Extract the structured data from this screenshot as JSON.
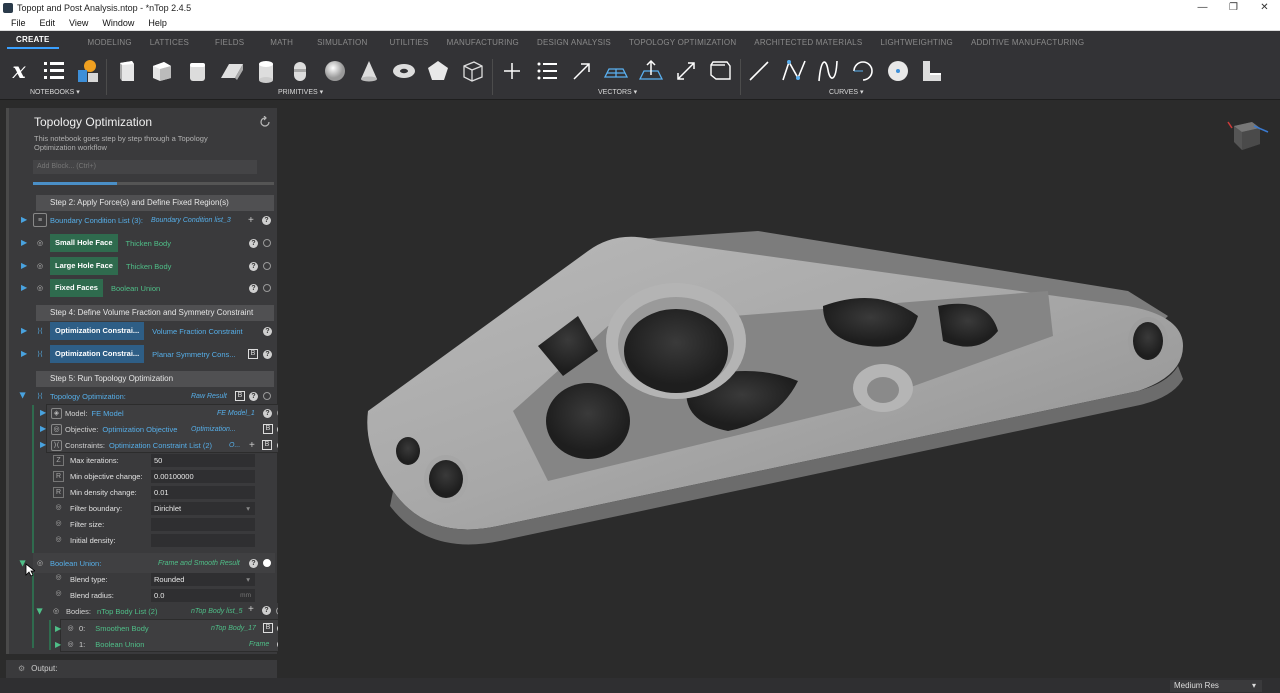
{
  "window": {
    "title": "Topopt and Post Analysis.ntop - *nTop 2.4.5",
    "controls": [
      "—",
      "❐",
      "✕"
    ]
  },
  "menu": [
    "File",
    "Edit",
    "View",
    "Window",
    "Help"
  ],
  "ribbon_tabs": [
    "CREATE",
    "MODELING",
    "LATTICES",
    "FIELDS",
    "MATH",
    "SIMULATION",
    "UTILITIES",
    "MANUFACTURING",
    "DESIGN ANALYSIS",
    "TOPOLOGY OPTIMIZATION",
    "ARCHITECTED MATERIALS",
    "LIGHTWEIGHTING",
    "ADDITIVE MANUFACTURING"
  ],
  "toolbar": {
    "notebooks_label": "NOTEBOOKS",
    "primitives_label": "PRIMITIVES",
    "vectors_label": "VECTORS",
    "curves_label": "CURVES",
    "variable_glyph": "x"
  },
  "notebook": {
    "title": "Topology Optimization",
    "description": "This notebook goes step by step through a Topology Optimization workflow",
    "add_block": "Add Block... (Ctrl+)",
    "progress": 0.35
  },
  "steps": {
    "step2": "Step 2: Apply Force(s) and Define Fixed Region(s)",
    "step4": "Step 4: Define Volume Fraction and Symmetry Constraint",
    "step5": "Step 5: Run Topology Optimization"
  },
  "rows": {
    "bc_list": {
      "name": "Boundary Condition List (3):",
      "value": "Boundary Condition list_3"
    },
    "small_hole": {
      "name": "Small Hole Face",
      "value": "Thicken Body"
    },
    "large_hole": {
      "name": "Large Hole Face",
      "value": "Thicken Body"
    },
    "fixed_faces": {
      "name": "Fixed Faces",
      "value": "Boolean Union"
    },
    "opt_con_1": {
      "name": "Optimization Constrai...",
      "value": "Volume Fraction Constraint"
    },
    "opt_con_2": {
      "name": "Optimization Constrai...",
      "value": "Planar Symmetry Cons..."
    },
    "topopt": {
      "name": "Topology Optimization:",
      "value": "Raw Result"
    },
    "model": {
      "label": "Model:",
      "name": "FE Model",
      "value": "FE Model_1"
    },
    "objective": {
      "label": "Objective:",
      "name": "Optimization Objective",
      "value": "Optimization..."
    },
    "constraints": {
      "label": "Constraints:",
      "name": "Optimization Constraint List (2)",
      "value": "O..."
    },
    "boolean_union": {
      "name": "Boolean Union:",
      "value": "Frame and Smooth Result"
    },
    "bodies": {
      "label": "Bodies:",
      "name": "nTop Body List (2)",
      "value": "nTop Body list_5"
    },
    "body0": {
      "index": "0:",
      "name": "Smoothen Body",
      "value": "nTop Body_17"
    },
    "body1": {
      "index": "1:",
      "name": "Boolean Union",
      "value": "Frame"
    }
  },
  "params": {
    "max_iter": {
      "label": "Max iterations:",
      "value": "50"
    },
    "min_obj": {
      "label": "Min objective change:",
      "value": "0.00100000"
    },
    "min_den": {
      "label": "Min density change:",
      "value": "0.01"
    },
    "filter_boundary": {
      "label": "Filter boundary:",
      "value": "Dirichlet"
    },
    "filter_size": {
      "label": "Filter size:",
      "value": ""
    },
    "initial_density": {
      "label": "Initial density:",
      "value": ""
    },
    "blend_type": {
      "label": "Blend type:",
      "value": "Rounded"
    },
    "blend_radius": {
      "label": "Blend radius:",
      "value": "0.0",
      "unit": "mm"
    }
  },
  "glyphs": {
    "help": "?",
    "bounds": "B",
    "add": "+",
    "param_z": "Z",
    "param_r": "R"
  },
  "output": {
    "label": "Output:"
  },
  "status": {
    "resolution": "Medium Res"
  },
  "colors": {
    "accent": "#3aa0ff",
    "green_tag": "#2f6b4e",
    "blue_tag": "#2e5e86",
    "viewport_bg": "#2b2b2b"
  }
}
